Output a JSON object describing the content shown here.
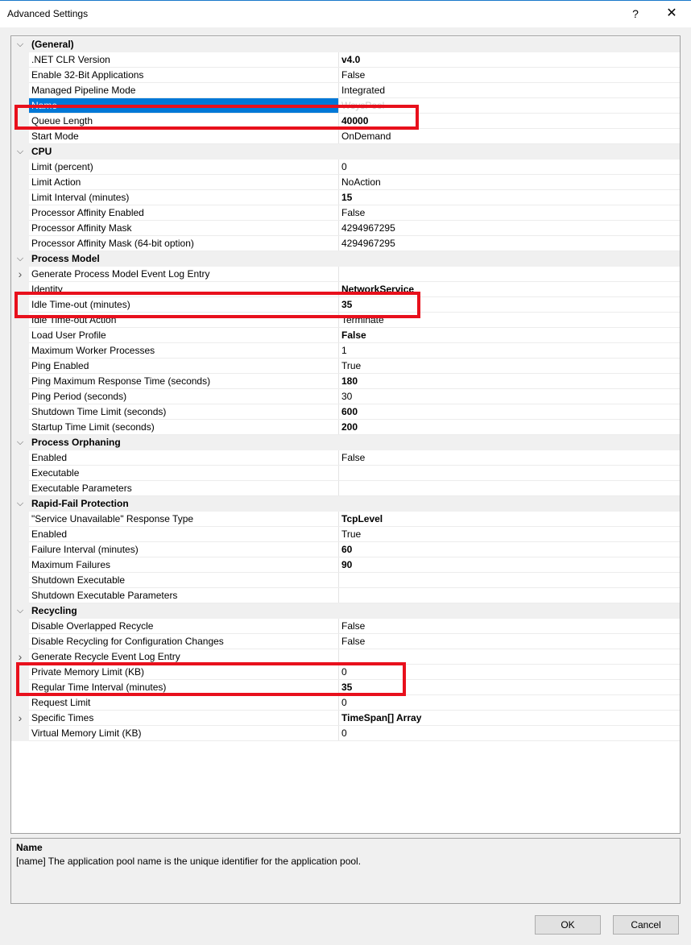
{
  "window": {
    "title": "Advanced Settings",
    "help_label": "?",
    "close_label": "✕"
  },
  "rows": [
    {
      "type": "cat",
      "label": "(General)"
    },
    {
      "name": ".NET CLR Version",
      "value": "v4.0",
      "bold": true
    },
    {
      "name": "Enable 32-Bit Applications",
      "value": "False"
    },
    {
      "name": "Managed Pipeline Mode",
      "value": "Integrated"
    },
    {
      "name": "Name",
      "value": "WsysPool",
      "selected": true
    },
    {
      "name": "Queue Length",
      "value": "40000",
      "bold": true
    },
    {
      "name": "Start Mode",
      "value": "OnDemand"
    },
    {
      "type": "cat",
      "label": "CPU"
    },
    {
      "name": "Limit (percent)",
      "value": "0"
    },
    {
      "name": "Limit Action",
      "value": "NoAction"
    },
    {
      "name": "Limit Interval (minutes)",
      "value": "15",
      "bold": true
    },
    {
      "name": "Processor Affinity Enabled",
      "value": "False"
    },
    {
      "name": "Processor Affinity Mask",
      "value": "4294967295"
    },
    {
      "name": "Processor Affinity Mask (64-bit option)",
      "value": "4294967295"
    },
    {
      "type": "cat",
      "label": "Process Model"
    },
    {
      "name": "Generate Process Model Event Log Entry",
      "value": "",
      "expand": true
    },
    {
      "name": "Identity",
      "value": "NetworkService",
      "bold": true
    },
    {
      "name": "Idle Time-out (minutes)",
      "value": "35",
      "bold": true
    },
    {
      "name": "Idle Time-out Action",
      "value": "Terminate"
    },
    {
      "name": "Load User Profile",
      "value": "False",
      "bold": true
    },
    {
      "name": "Maximum Worker Processes",
      "value": "1"
    },
    {
      "name": "Ping Enabled",
      "value": "True"
    },
    {
      "name": "Ping Maximum Response Time (seconds)",
      "value": "180",
      "bold": true
    },
    {
      "name": "Ping Period (seconds)",
      "value": "30"
    },
    {
      "name": "Shutdown Time Limit (seconds)",
      "value": "600",
      "bold": true
    },
    {
      "name": "Startup Time Limit (seconds)",
      "value": "200",
      "bold": true
    },
    {
      "type": "cat",
      "label": "Process Orphaning"
    },
    {
      "name": "Enabled",
      "value": "False"
    },
    {
      "name": "Executable",
      "value": ""
    },
    {
      "name": "Executable Parameters",
      "value": ""
    },
    {
      "type": "cat",
      "label": "Rapid-Fail Protection"
    },
    {
      "name": "\"Service Unavailable\" Response Type",
      "value": "TcpLevel",
      "bold": true
    },
    {
      "name": "Enabled",
      "value": "True"
    },
    {
      "name": "Failure Interval (minutes)",
      "value": "60",
      "bold": true
    },
    {
      "name": "Maximum Failures",
      "value": "90",
      "bold": true
    },
    {
      "name": "Shutdown Executable",
      "value": ""
    },
    {
      "name": "Shutdown Executable Parameters",
      "value": ""
    },
    {
      "type": "cat",
      "label": "Recycling"
    },
    {
      "name": "Disable Overlapped Recycle",
      "value": "False"
    },
    {
      "name": "Disable Recycling for Configuration Changes",
      "value": "False"
    },
    {
      "name": "Generate Recycle Event Log Entry",
      "value": "",
      "expand": true
    },
    {
      "name": "Private Memory Limit (KB)",
      "value": "0"
    },
    {
      "name": "Regular Time Interval (minutes)",
      "value": "35",
      "bold": true
    },
    {
      "name": "Request Limit",
      "value": "0"
    },
    {
      "name": "Specific Times",
      "value": "TimeSpan[] Array",
      "bold": true,
      "expand": true
    },
    {
      "name": "Virtual Memory Limit (KB)",
      "value": "0"
    }
  ],
  "description": {
    "title": "Name",
    "text": "[name] The application pool name is the unique identifier for the application pool."
  },
  "buttons": {
    "ok": "OK",
    "cancel": "Cancel"
  },
  "colors": {
    "highlight_box": "#e8101c",
    "selection": "#0078d7"
  }
}
